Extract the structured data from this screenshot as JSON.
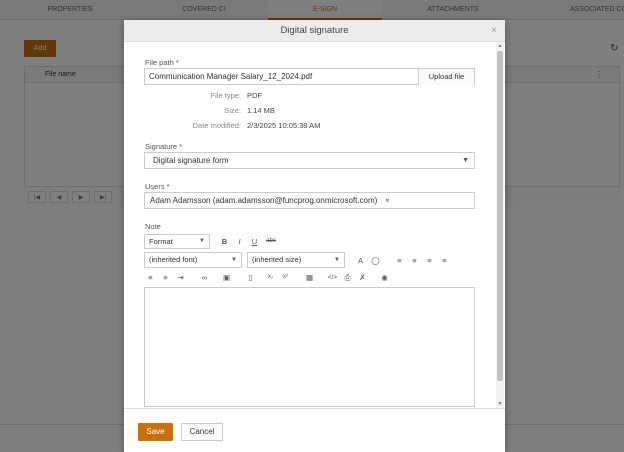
{
  "tabs": [
    "PROPERTIES",
    "COVERED CI",
    "E-SIGN",
    "ATTACHMENTS",
    "ASSOCIATED CONTRACTS"
  ],
  "background": {
    "add_label": "Add",
    "grid_column": "File name",
    "refresh_icon": "refresh-icon",
    "pager_icons": [
      "first-page-icon",
      "prev-page-icon",
      "next-page-icon",
      "last-page-icon"
    ]
  },
  "dialog": {
    "title": "Digital signature",
    "close_glyph": "×",
    "file_path_label": "File path *",
    "file_path_value": "Communication Manager Salary_12_2024.pdf",
    "upload_label": "Upload file",
    "file_type_label": "File type:",
    "file_type_value": "PDF",
    "size_label": "Size:",
    "size_value": "1.14 MB",
    "date_modified_label": "Date modified:",
    "date_modified_value": "2/3/2025 10:05:38 AM",
    "signature_label": "Signature *",
    "signature_value": "Digital signature form",
    "users_label": "Users *",
    "user_value": "Adam Adamsson (adam.adamsson@funcprog.onmicrosoft.com)",
    "user_remove_glyph": "×",
    "note_label": "Note",
    "editor": {
      "format_label": "Format",
      "font_label": "(inherited font)",
      "size_label": "(inherited size)",
      "bold": "B",
      "italic": "I",
      "underline": "U",
      "strikethrough": "abc",
      "text_color": "A",
      "subscript": "x₂",
      "superscript": "x²",
      "code": "</>"
    },
    "save_label": "Save",
    "cancel_label": "Cancel"
  },
  "colors": {
    "accent": "#c8700b"
  }
}
